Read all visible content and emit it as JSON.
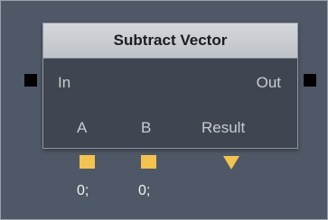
{
  "node": {
    "title": "Subtract Vector",
    "ports": {
      "in_label": "In",
      "out_label": "Out"
    },
    "params": [
      {
        "label": "A",
        "value": "0;"
      },
      {
        "label": "B",
        "value": "0;"
      },
      {
        "label": "Result"
      }
    ]
  },
  "colors": {
    "canvas": "#4f5866",
    "node_body": "#3f4651",
    "header": "#c9cdd2",
    "pin": "#f2c34f",
    "exec_pin": "#000000"
  }
}
